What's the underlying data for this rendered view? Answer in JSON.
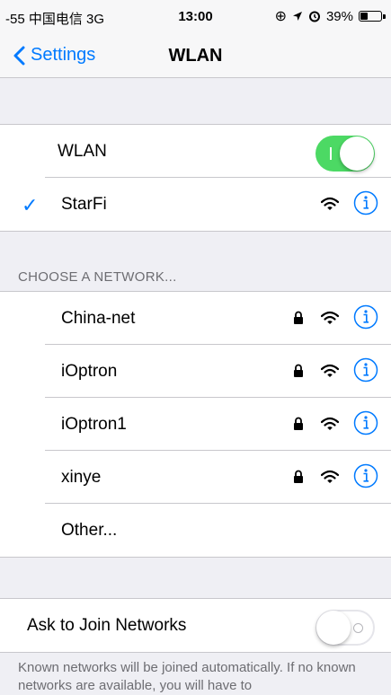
{
  "status_bar": {
    "carrier": "-55 中国电信 3G",
    "time": "13:00",
    "battery_percent": "39%",
    "battery_level": 0.39
  },
  "nav": {
    "back_label": "Settings",
    "title": "WLAN"
  },
  "wlan": {
    "label": "WLAN",
    "enabled": true,
    "connected_network": "StarFi"
  },
  "choose_header": "CHOOSE A NETWORK...",
  "networks": [
    {
      "name": "China-net",
      "secured": true
    },
    {
      "name": "iOptron",
      "secured": true
    },
    {
      "name": "iOptron1",
      "secured": true
    },
    {
      "name": "xinye",
      "secured": true
    }
  ],
  "other_label": "Other...",
  "ask_to_join": {
    "label": "Ask to Join Networks",
    "enabled": false
  },
  "footer": "Known networks will be joined automatically. If no known networks are available, you will have to",
  "colors": {
    "accent": "#007aff",
    "toggle_on": "#4cd964",
    "background": "#efeff4"
  }
}
